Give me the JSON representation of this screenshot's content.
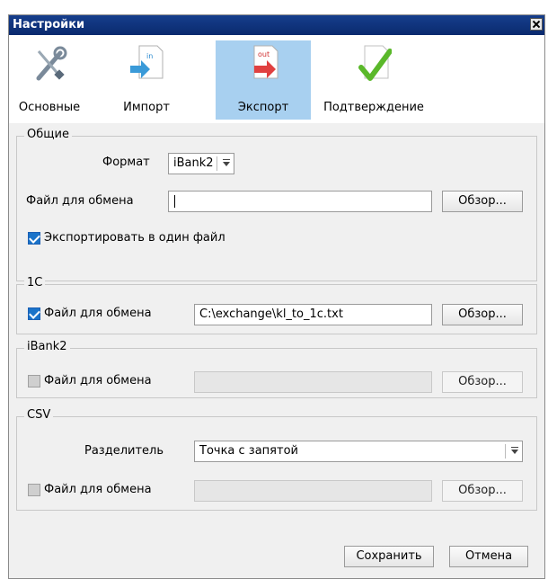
{
  "window": {
    "title": "Настройки"
  },
  "tabs": [
    {
      "label": "Основные",
      "icon": "wrench-screwdriver-icon"
    },
    {
      "label": "Импорт",
      "icon": "import-icon"
    },
    {
      "label": "Экспорт",
      "icon": "export-icon",
      "active": true
    },
    {
      "label": "Подтверждение",
      "icon": "checkmark-icon"
    }
  ],
  "general": {
    "legend": "Общие",
    "format_label": "Формат",
    "format_value": "iBank2",
    "file_label": "Файл для обмена",
    "file_value": "",
    "browse": "Обзор...",
    "single_file_label": "Экспортировать в один файл",
    "single_file_checked": true
  },
  "onec": {
    "legend": "1С",
    "file_label": "Файл для обмена",
    "file_value": "C:\\exchange\\kl_to_1c.txt",
    "checked": true,
    "browse": "Обзор..."
  },
  "ibank2": {
    "legend": "iBank2",
    "file_label": "Файл для обмена",
    "file_value": "",
    "checked": false,
    "browse": "Обзор..."
  },
  "csv": {
    "legend": "CSV",
    "separator_label": "Разделитель",
    "separator_value": "Точка с запятой",
    "file_label": "Файл для обмена",
    "file_value": "",
    "checked": false,
    "browse": "Обзор..."
  },
  "footer": {
    "save": "Сохранить",
    "cancel": "Отмена"
  },
  "colors": {
    "titlebar": "#163e8c",
    "active_tab": "#a8d0f0",
    "checkbox": "#1a73c9"
  }
}
